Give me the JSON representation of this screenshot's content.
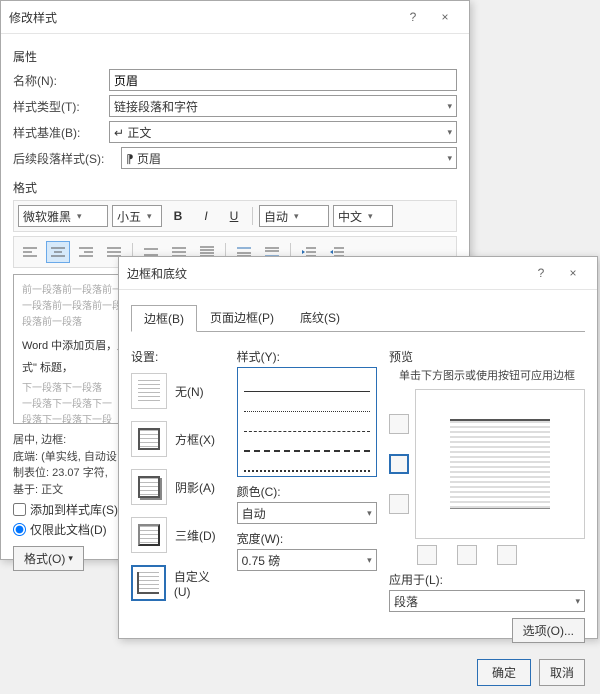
{
  "modifyDialog": {
    "title": "修改样式",
    "help": "?",
    "close": "×",
    "propsLabel": "属性",
    "name_lbl": "名称(N):",
    "name_val": "页眉",
    "type_lbl": "样式类型(T):",
    "type_val": "链接段落和字符",
    "base_lbl": "样式基准(B):",
    "base_val": "↵ 正文",
    "follow_lbl": "后续段落样式(S):",
    "follow_val": "⁋ 页眉",
    "formatLabel": "格式",
    "font_name": "微软雅黑",
    "font_size": "小五",
    "bold": "B",
    "italic": "I",
    "underline": "U",
    "color": "自动",
    "lang": "中文",
    "pv_grey": "前一段落前一段落前一段落前一段落前一段落前一段落前一段落前一段落前一段落前一段落前一段落",
    "pv_grey2": "一段落前一段落前一段落前一段落前一段落前一段落",
    "pv_grey3": "段落前一段落",
    "pv_main": "Word 中添加页眉，后",
    "pv_main2": "式\" 标题，",
    "pv_next": "下一段落下一段落",
    "pv_next2": "一段落下一段落下一",
    "pv_next3": "段落下一段落下一段",
    "footer_line1": "居中, 边框:",
    "footer_line2": "底端: (单实线, 自动设",
    "footer_line3": "制表位: 23.07 字符,",
    "footer_line4": "基于: 正文",
    "add_to_lib": "添加到样式库(S)",
    "only_doc": "仅限此文档(D)",
    "format_btn": "格式(O)"
  },
  "borderDialog": {
    "title": "边框和底纹",
    "help": "?",
    "close": "×",
    "tab1": "边框(B)",
    "tab2": "页面边框(P)",
    "tab3": "底纹(S)",
    "settings_lbl": "设置:",
    "set_none": "无(N)",
    "set_box": "方框(X)",
    "set_shadow": "阴影(A)",
    "set_3d": "三维(D)",
    "set_custom": "自定义(U)",
    "style_lbl": "样式(Y):",
    "color_lbl": "颜色(C):",
    "color_val": "自动",
    "width_lbl": "宽度(W):",
    "width_val": "0.75 磅",
    "preview_lbl": "预览",
    "preview_hint": "单击下方图示或使用按钮可应用边框",
    "apply_lbl": "应用于(L):",
    "apply_val": "段落",
    "options_btn": "选项(O)...",
    "ok": "确定",
    "cancel": "取消"
  }
}
